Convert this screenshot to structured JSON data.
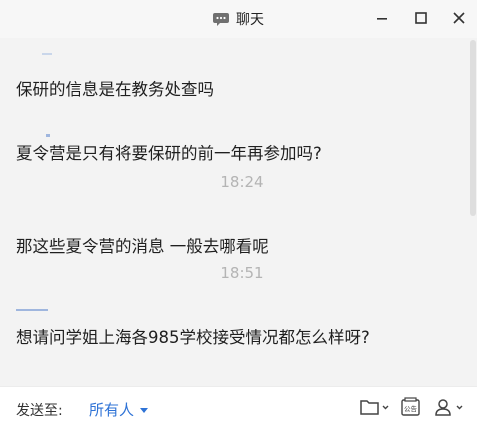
{
  "window": {
    "title": "聊天",
    "title_icon": "chat-bubble-icon",
    "controls": [
      "minimize-icon",
      "maximize-icon",
      "close-icon"
    ]
  },
  "messages": [
    {
      "type": "text",
      "text": "保研的信息是在教务处查吗"
    },
    {
      "type": "text",
      "text": "夏令营是只有将要保研的前一年再参加吗?"
    },
    {
      "type": "time",
      "text": "18:24"
    },
    {
      "type": "text",
      "text": "那这些夏令营的消息 一般去哪看呢"
    },
    {
      "type": "time",
      "text": "18:51"
    },
    {
      "type": "text",
      "text": "想请问学姐上海各985学校接受情况都怎么样呀?"
    }
  ],
  "footer": {
    "send_to_label": "发送至:",
    "recipient": "所有人",
    "tools": [
      "folder-icon",
      "announcement-icon",
      "members-icon"
    ]
  },
  "colors": {
    "background": "#f3f3f3",
    "accent": "#2f73d6",
    "timestamp": "#b4b4b4"
  }
}
